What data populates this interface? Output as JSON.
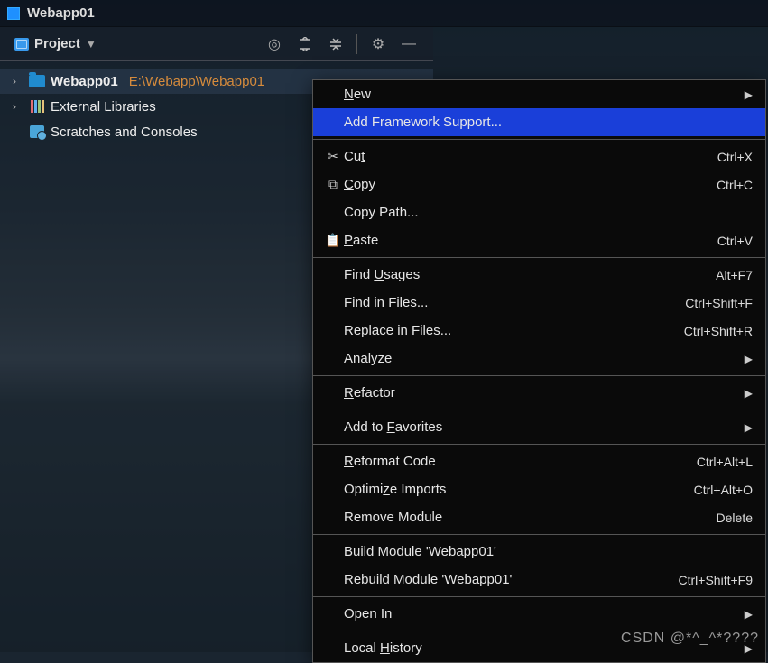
{
  "app_title": "Webapp01",
  "toolbar": {
    "project_label": "Project"
  },
  "tree": {
    "root": {
      "label": "Webapp01",
      "path": "E:\\Webapp\\Webapp01"
    },
    "external": {
      "label": "External Libraries"
    },
    "scratch": {
      "label": "Scratches and Consoles"
    }
  },
  "menu": {
    "new": "New",
    "add_framework": "Add Framework Support...",
    "cut": "Cut",
    "cut_sc": "Ctrl+X",
    "copy": "Copy",
    "copy_sc": "Ctrl+C",
    "copy_path": "Copy Path...",
    "paste": "Paste",
    "paste_sc": "Ctrl+V",
    "find_usages": "Find Usages",
    "find_usages_sc": "Alt+F7",
    "find_in_files": "Find in Files...",
    "find_in_files_sc": "Ctrl+Shift+F",
    "replace_in_files": "Replace in Files...",
    "replace_in_files_sc": "Ctrl+Shift+R",
    "analyze": "Analyze",
    "refactor": "Refactor",
    "add_favorites": "Add to Favorites",
    "reformat": "Reformat Code",
    "reformat_sc": "Ctrl+Alt+L",
    "optimize": "Optimize Imports",
    "optimize_sc": "Ctrl+Alt+O",
    "remove_module": "Remove Module",
    "remove_module_sc": "Delete",
    "build": "Build Module 'Webapp01'",
    "rebuild": "Rebuild Module 'Webapp01'",
    "rebuild_sc": "Ctrl+Shift+F9",
    "open_in": "Open In",
    "local_history": "Local History"
  },
  "watermark": "CSDN @*^_^*????"
}
